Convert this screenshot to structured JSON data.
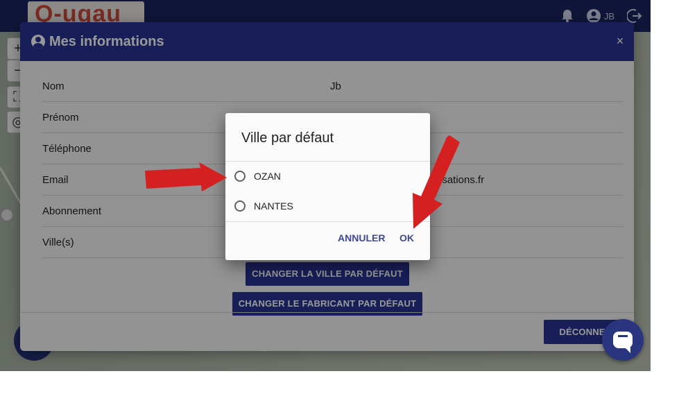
{
  "app": {
    "logo_text": "Q-uqau",
    "user_initials": "JB"
  },
  "modal": {
    "title": "Mes informations",
    "close_label": "×",
    "rows": [
      {
        "label": "Nom",
        "value": "Jb"
      },
      {
        "label": "Prénom",
        "value": ""
      },
      {
        "label": "Téléphone",
        "value": ""
      },
      {
        "label": "Email",
        "value": "isations.fr"
      },
      {
        "label": "Abonnement",
        "value": ""
      },
      {
        "label": "Ville(s)",
        "value": ""
      }
    ],
    "change_city_button": "CHANGER LA VILLE PAR DÉFAUT",
    "change_maker_button": "CHANGER LE FABRICANT PAR DÉFAUT",
    "logout_button": "DÉCONNEX"
  },
  "dialog": {
    "title": "Ville par défaut",
    "options": [
      "OZAN",
      "NANTES"
    ],
    "cancel_label": "ANNULER",
    "ok_label": "OK"
  },
  "colors": {
    "header": "#283593",
    "arrow": "#d42020",
    "chat": "#2a3580"
  },
  "icons": {
    "bell": "bell-icon",
    "account": "account-icon",
    "logout": "logout-icon",
    "chat": "chat-icon"
  }
}
